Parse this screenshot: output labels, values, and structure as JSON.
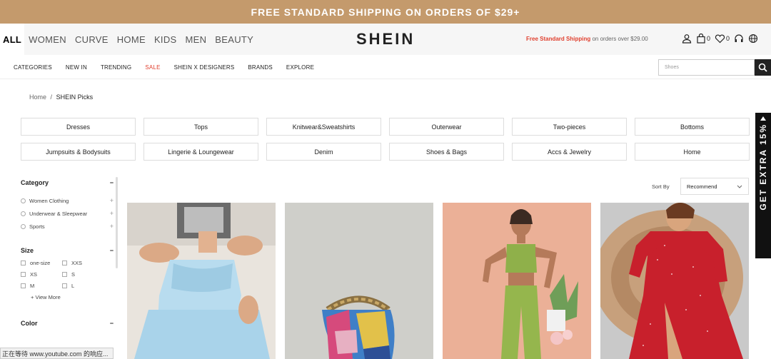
{
  "promo": {
    "text": "FREE STANDARD SHIPPING ON ORDERS OF $29+"
  },
  "channels": [
    {
      "label": "ALL"
    },
    {
      "label": "WOMEN"
    },
    {
      "label": "CURVE"
    },
    {
      "label": "HOME"
    },
    {
      "label": "KIDS"
    },
    {
      "label": "MEN"
    },
    {
      "label": "BEAUTY"
    }
  ],
  "logo": "SHEIN",
  "ship_note": {
    "highlight": "Free Standard Shipping",
    "rest": " on orders over $29.00"
  },
  "header_icons": {
    "cart_count": "0",
    "wishlist_count": "0"
  },
  "nav2": {
    "items": [
      "CATEGORIES",
      "NEW IN",
      "TRENDING",
      "SALE",
      "SHEIN X DESIGNERS",
      "BRANDS",
      "EXPLORE"
    ],
    "search_placeholder": "Shoes"
  },
  "breadcrumb": {
    "home": "Home",
    "sep": "/",
    "current": "SHEIN Picks"
  },
  "category_buttons": [
    "Dresses",
    "Tops",
    "Knitwear&Sweatshirts",
    "Outerwear",
    "Two-pieces",
    "Bottoms",
    "Jumpsuits & Bodysuits",
    "Lingerie & Loungewear",
    "Denim",
    "Shoes & Bags",
    "Accs & Jewelry",
    "Home"
  ],
  "filters": {
    "category": {
      "title": "Category",
      "items": [
        "Women Clothing",
        "Underwear & Sleepwear",
        "Sports"
      ]
    },
    "size": {
      "title": "Size",
      "items": [
        "one-size",
        "XXS",
        "XS",
        "S",
        "M",
        "L"
      ],
      "view_more": "+ View More"
    },
    "color": {
      "title": "Color"
    }
  },
  "sort": {
    "label": "Sort By",
    "value": "Recommend"
  },
  "side_tab": {
    "text": "GET EXTRA 15%"
  },
  "status_bar": {
    "text": "正在等待 www.youtube.com 的响应..."
  }
}
